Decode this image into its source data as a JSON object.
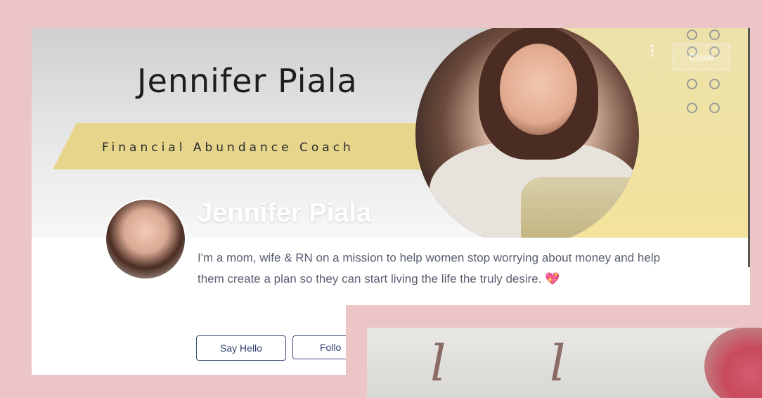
{
  "banner": {
    "name": "Jennifer Piala",
    "tagline": "Financial Abundance Coach"
  },
  "header": {
    "close_label": "Close"
  },
  "profile": {
    "name": "Jennifer Piala",
    "bio": "I'm a mom, wife & RN on a mission to help women stop worrying about money and help them create a plan so they can start living the life the truly desire. 💖"
  },
  "actions": {
    "say_hello": "Say Hello",
    "follow": "Follo"
  },
  "overlay": {
    "script_left": "l",
    "script_right": "l"
  }
}
